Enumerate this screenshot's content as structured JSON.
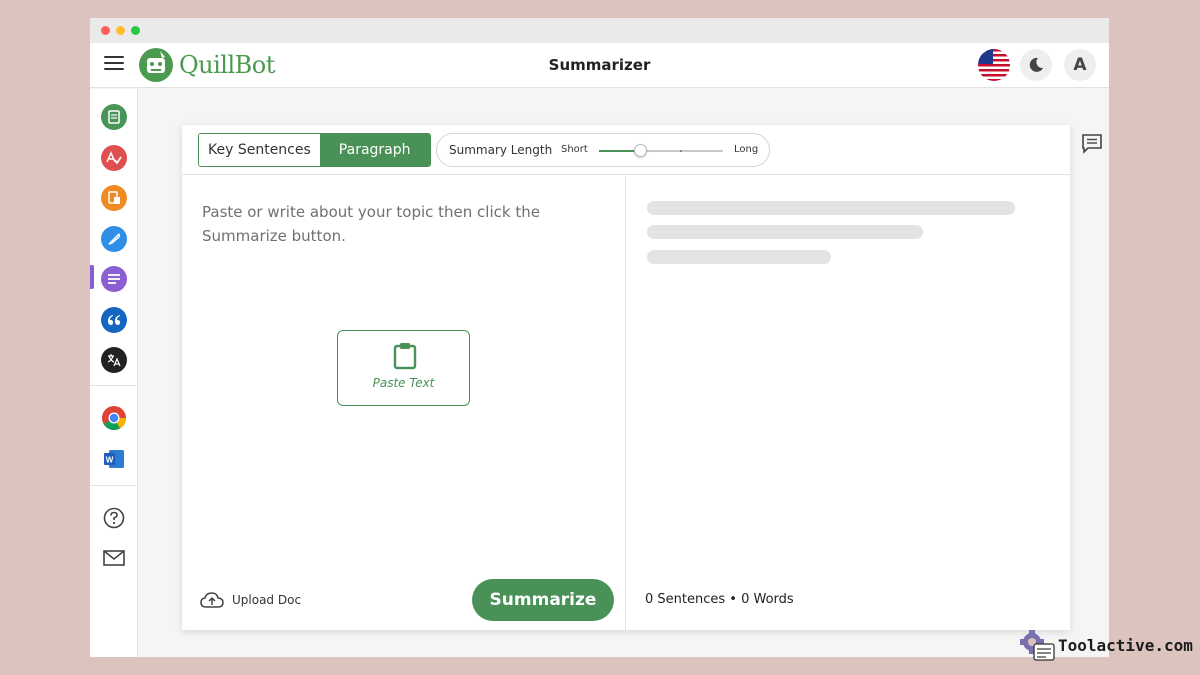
{
  "app": {
    "brand": "QuillBot",
    "title": "Summarizer"
  },
  "header": {
    "account_initial": "A"
  },
  "sidebar": {
    "items": [
      {
        "name": "paraphraser",
        "icon": "paraphraser-icon",
        "color": "#499557"
      },
      {
        "name": "grammar-checker",
        "icon": "grammar-check-icon",
        "color": "#e04f4f"
      },
      {
        "name": "plagiarism-checker",
        "icon": "plagiarism-icon",
        "color": "#f08a24"
      },
      {
        "name": "co-writer",
        "icon": "feather-icon",
        "color": "#2f8fe6"
      },
      {
        "name": "summarizer",
        "icon": "summarizer-icon",
        "color": "#8a5fd1",
        "active": true
      },
      {
        "name": "citation-generator",
        "icon": "quote-icon",
        "color": "#1466c0"
      },
      {
        "name": "translator",
        "icon": "translate-icon",
        "color": "#222222"
      },
      {
        "name": "chrome-extension",
        "icon": "chrome-icon"
      },
      {
        "name": "word-addin",
        "icon": "word-icon",
        "color": "#1f5fb8"
      },
      {
        "name": "help",
        "icon": "help-icon"
      },
      {
        "name": "contact",
        "icon": "mail-icon"
      }
    ]
  },
  "modes": {
    "key_sentences": "Key Sentences",
    "paragraph": "Paragraph",
    "active": "paragraph"
  },
  "summary_length": {
    "label": "Summary Length",
    "short": "Short",
    "long": "Long",
    "value": 0.33
  },
  "input": {
    "placeholder": "Paste or write about your topic then click the Summarize button.",
    "paste_label": "Paste Text"
  },
  "footer": {
    "upload_label": "Upload Doc",
    "summarize_label": "Summarize",
    "counts": "0 Sentences • 0 Words"
  },
  "watermark": {
    "text": "Toolactive.com"
  },
  "colors": {
    "brand_green": "#4a9157",
    "background": "#dcc3bd"
  }
}
